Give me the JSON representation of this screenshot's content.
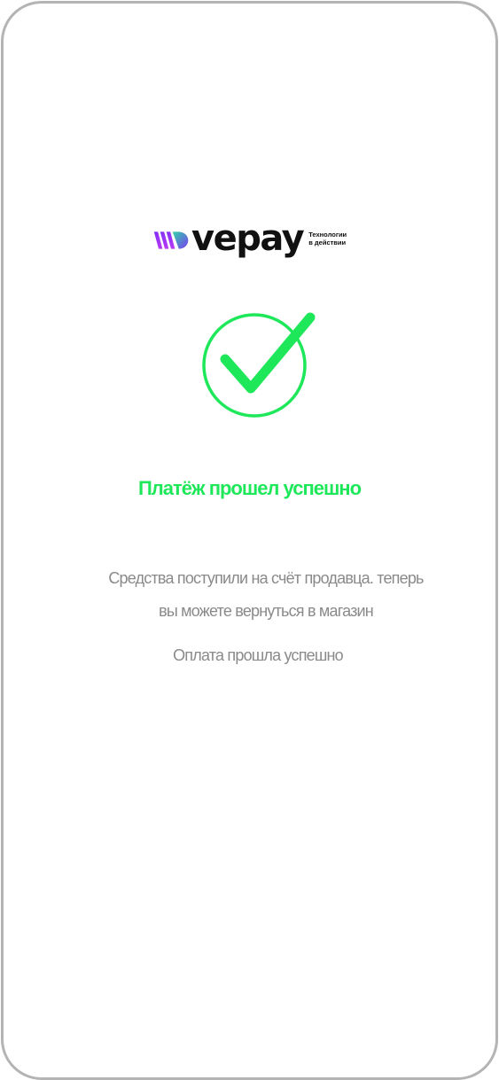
{
  "brand": {
    "logo_name": "vepay",
    "tagline_line1": "Технологии",
    "tagline_line2": "в действии",
    "accent_colors": [
      "#8a2be2",
      "#b02cf0",
      "#1fd6a0"
    ]
  },
  "status_icon": {
    "icon": "checkmark-circle-icon",
    "color": "#1ee85a"
  },
  "payment": {
    "title": "Платёж прошел успешно",
    "message_line1": "Средства поступили на счёт продавца. теперь",
    "message_line2": "вы можете вернуться в магазин",
    "status_text": "Оплата прошла успешно"
  }
}
